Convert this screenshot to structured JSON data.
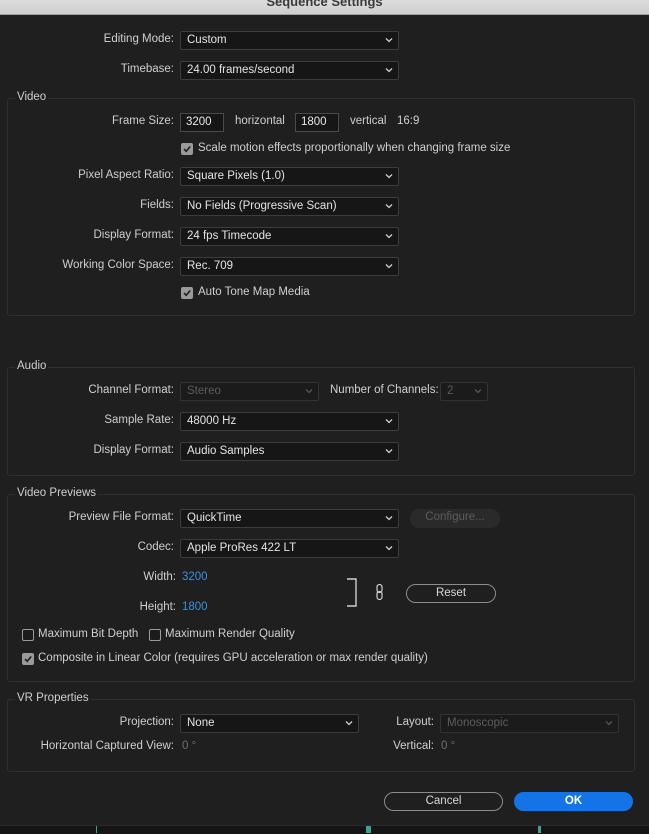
{
  "window": {
    "title": "Sequence Settings"
  },
  "general": {
    "editing_mode_label": "Editing Mode:",
    "editing_mode_value": "Custom",
    "timebase_label": "Timebase:",
    "timebase_value": "24.00  frames/second"
  },
  "video": {
    "section_title": "Video",
    "frame_size_label": "Frame Size:",
    "frame_width": "3200",
    "horizontal_label": "horizontal",
    "frame_height": "1800",
    "vertical_label": "vertical",
    "aspect": "16:9",
    "scale_motion_label": "Scale motion effects proportionally when changing frame size",
    "scale_motion_checked": true,
    "par_label": "Pixel Aspect Ratio:",
    "par_value": "Square Pixels (1.0)",
    "fields_label": "Fields:",
    "fields_value": "No Fields (Progressive Scan)",
    "display_format_label": "Display Format:",
    "display_format_value": "24 fps Timecode",
    "color_space_label": "Working Color Space:",
    "color_space_value": "Rec. 709",
    "tone_map_label": "Auto Tone Map Media",
    "tone_map_checked": true
  },
  "audio": {
    "section_title": "Audio",
    "channel_format_label": "Channel Format:",
    "channel_format_value": "Stereo",
    "num_channels_label": "Number of Channels:",
    "num_channels_value": "2",
    "sample_rate_label": "Sample Rate:",
    "sample_rate_value": "48000 Hz",
    "display_format_label": "Display Format:",
    "display_format_value": "Audio Samples"
  },
  "previews": {
    "section_title": "Video Previews",
    "file_format_label": "Preview File Format:",
    "file_format_value": "QuickTime",
    "configure_label": "Configure...",
    "codec_label": "Codec:",
    "codec_value": "Apple ProRes 422 LT",
    "width_label": "Width:",
    "width_value": "3200",
    "height_label": "Height:",
    "height_value": "1800",
    "reset_label": "Reset",
    "max_bit_depth_label": "Maximum Bit Depth",
    "max_bit_depth_checked": false,
    "max_render_quality_label": "Maximum Render Quality",
    "max_render_quality_checked": false,
    "composite_linear_label": "Composite in Linear Color (requires GPU acceleration or max render quality)",
    "composite_linear_checked": true
  },
  "vr": {
    "section_title": "VR Properties",
    "projection_label": "Projection:",
    "projection_value": "None",
    "layout_label": "Layout:",
    "layout_value": "Monoscopic",
    "h_view_label": "Horizontal Captured View:",
    "h_view_value": "0 °",
    "vertical_label": "Vertical:",
    "vertical_value": "0 °"
  },
  "footer": {
    "cancel_label": "Cancel",
    "ok_label": "OK"
  },
  "colors": {
    "accent": "#1473e6",
    "value_blue": "#3d8fe0",
    "background": "#1f1f1f"
  },
  "icons": {
    "dropdown": "chevron-down-icon",
    "link": "chain-link-icon",
    "check": "checkmark-icon"
  }
}
